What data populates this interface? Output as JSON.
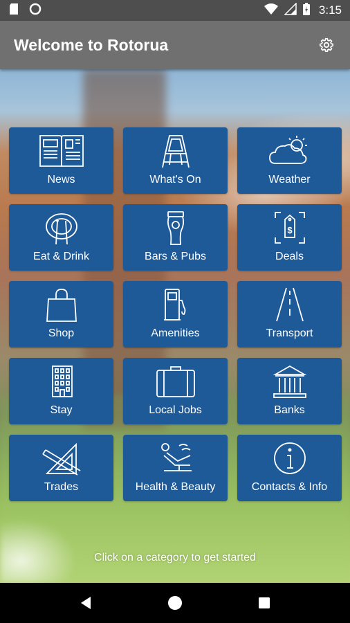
{
  "status_bar": {
    "time": "3:15",
    "icons": [
      "sd-card-icon",
      "circle-notification-icon",
      "wifi-icon",
      "signal-icon",
      "battery-icon"
    ]
  },
  "app_bar": {
    "title": "Welcome to Rotorua",
    "settings_icon": "gear-icon"
  },
  "categories": [
    {
      "label": "News",
      "icon": "newspaper-icon"
    },
    {
      "label": "What's On",
      "icon": "sign-board-icon"
    },
    {
      "label": "Weather",
      "icon": "weather-icon"
    },
    {
      "label": "Eat & Drink",
      "icon": "plate-cutlery-icon"
    },
    {
      "label": "Bars & Pubs",
      "icon": "beer-glass-icon"
    },
    {
      "label": "Deals",
      "icon": "price-tag-icon"
    },
    {
      "label": "Shop",
      "icon": "shopping-bag-icon"
    },
    {
      "label": "Amenities",
      "icon": "fuel-pump-icon"
    },
    {
      "label": "Transport",
      "icon": "road-icon"
    },
    {
      "label": "Stay",
      "icon": "building-icon"
    },
    {
      "label": "Local Jobs",
      "icon": "briefcase-icon"
    },
    {
      "label": "Banks",
      "icon": "bank-icon"
    },
    {
      "label": "Trades",
      "icon": "set-square-icon"
    },
    {
      "label": "Health & Beauty",
      "icon": "salon-chair-icon"
    },
    {
      "label": "Contacts & Info",
      "icon": "info-icon"
    }
  ],
  "hint": "Click on a category to get started",
  "nav_bar": {
    "icons": [
      "back-icon",
      "home-icon",
      "recents-icon"
    ]
  }
}
